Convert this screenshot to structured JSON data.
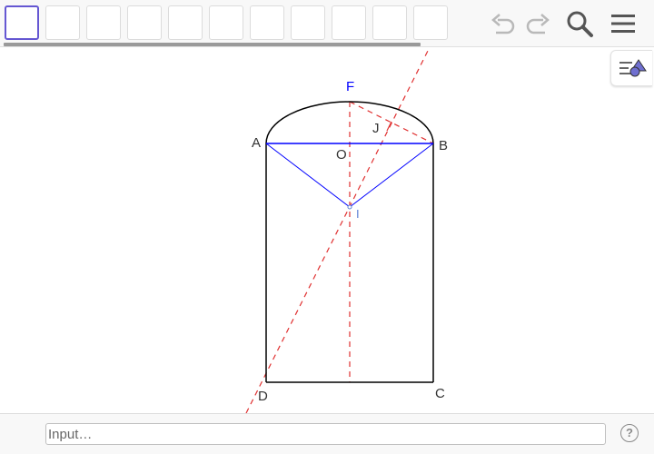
{
  "toolbar": {
    "tool_count": 11,
    "active_tool_index": 0,
    "icons": [
      "undo-icon",
      "redo-icon",
      "search-icon",
      "menu-icon"
    ]
  },
  "stylebar": {
    "icon": "style-bar-icon"
  },
  "construction": {
    "labels": {
      "A": "A",
      "B": "B",
      "C": "C",
      "D": "D",
      "O": "O",
      "F": "F",
      "J": "J",
      "I": "I"
    },
    "colors": {
      "segment": "#000000",
      "chord": "#0000ff",
      "dashed": "#e03030",
      "label_F": "#0000ff",
      "label_I": "#5b7fd6"
    }
  },
  "inputbar": {
    "placeholder": "Input…",
    "help": "?"
  }
}
